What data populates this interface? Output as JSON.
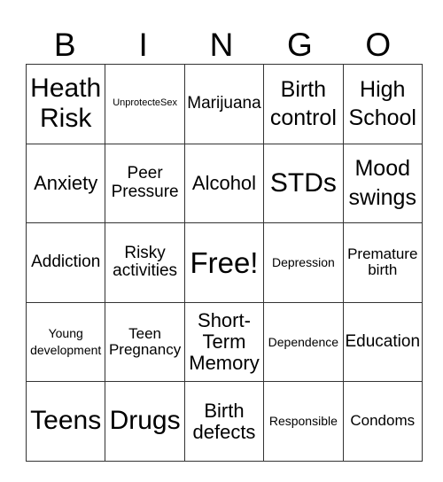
{
  "header": {
    "letters": [
      "B",
      "I",
      "N",
      "G",
      "O"
    ]
  },
  "board": {
    "rows": [
      [
        "Heath Risk",
        "UnprotecteSex",
        "Marijuana",
        "Birth control",
        "High School"
      ],
      [
        "Anxiety",
        "Peer Pressure",
        "Alcohol",
        "STDs",
        "Mood swings"
      ],
      [
        "Addiction",
        "Risky activities",
        "Free!",
        "Depression",
        "Premature birth"
      ],
      [
        "Young development",
        "Teen Pregnancy",
        "Short-Term Memory",
        "Dependence",
        "Education"
      ],
      [
        "Teens",
        "Drugs",
        "Birth defects",
        "Responsible",
        "Condoms"
      ]
    ]
  }
}
